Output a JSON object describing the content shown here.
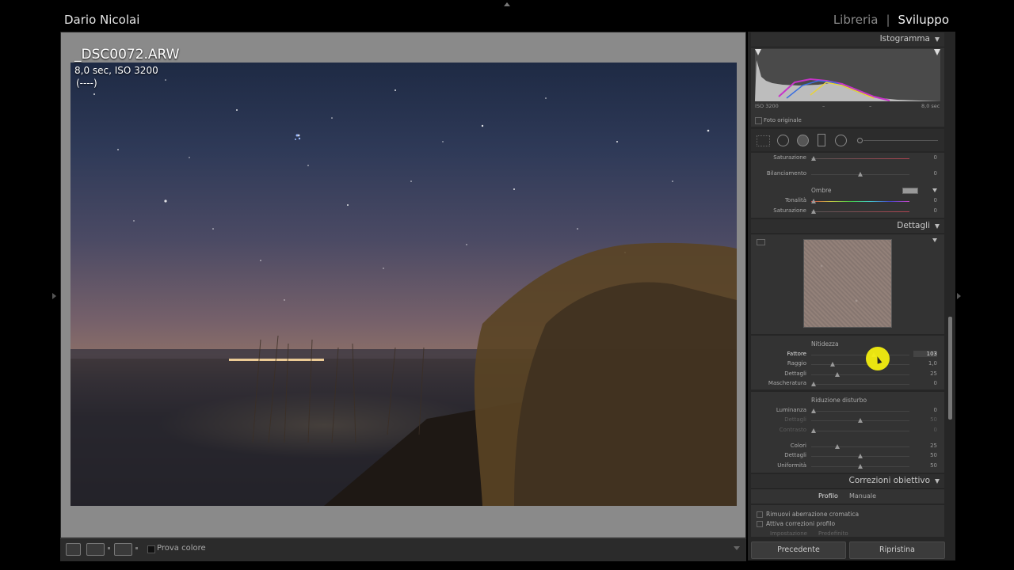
{
  "header": {
    "user": "Dario Nicolai",
    "module_library": "Libreria",
    "module_separator": "|",
    "module_develop": "Sviluppo"
  },
  "viewer": {
    "filename": "_DSC0072.ARW",
    "exif_line1": "8,0 sec, ISO 3200",
    "exif_line2": "(----)"
  },
  "toolbar": {
    "proof_label": "Prova colore"
  },
  "histogram": {
    "title": "Istogramma",
    "iso": "ISO 3200",
    "dash1": "–",
    "dash2": "–",
    "shutter": "8,0 sec",
    "original_label": "Foto originale"
  },
  "split_toning": {
    "rows_top": [
      {
        "label": "Saturazione",
        "value": "0"
      },
      {
        "label": "Bilanciamento",
        "value": "0"
      }
    ],
    "shadows_title": "Ombre",
    "rows_shadows": [
      {
        "label": "Tonalità",
        "value": "0"
      },
      {
        "label": "Saturazione",
        "value": "0"
      }
    ]
  },
  "details": {
    "title": "Dettagli",
    "sharpening_title": "Nitidezza",
    "sharpening": [
      {
        "label": "Fattore",
        "value": "103"
      },
      {
        "label": "Raggio",
        "value": "1,0"
      },
      {
        "label": "Dettagli",
        "value": "25"
      },
      {
        "label": "Mascheratura",
        "value": "0"
      }
    ],
    "noise_title": "Riduzione disturbo",
    "noise": [
      {
        "label": "Luminanza",
        "value": "0"
      },
      {
        "label": "Dettagli",
        "value": "50"
      },
      {
        "label": "Contrasto",
        "value": "0"
      },
      {
        "label": "Colori",
        "value": "25"
      },
      {
        "label": "Dettagli",
        "value": "50"
      },
      {
        "label": "Uniformità",
        "value": "50"
      }
    ]
  },
  "lens": {
    "title": "Correzioni obiettivo",
    "tab_profile": "Profilo",
    "tab_manual": "Manuale",
    "check1": "Rimuovi aberrazione cromatica",
    "check2": "Attiva correzioni profilo",
    "setting_label": "Impostazione",
    "setting_value": "Predefinito"
  },
  "buttons": {
    "previous": "Precedente",
    "reset": "Ripristina"
  }
}
